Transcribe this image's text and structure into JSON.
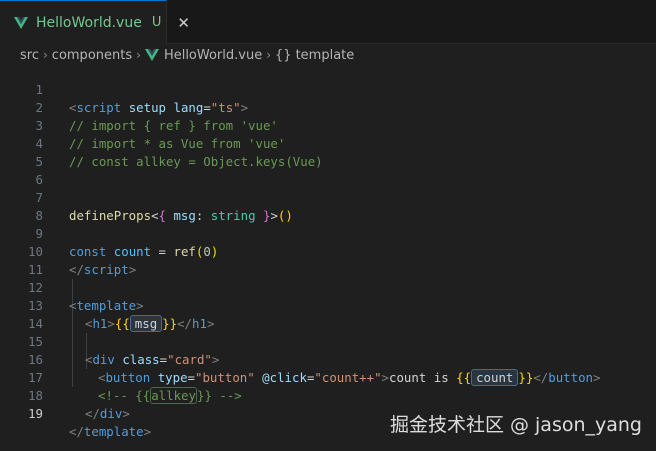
{
  "tab": {
    "title": "HelloWorld.vue",
    "status": "U",
    "close_glyph": "✕",
    "icon": "vue-icon"
  },
  "breadcrumb": {
    "items": [
      "src",
      "components",
      "HelloWorld.vue",
      "template"
    ],
    "braces": "{}",
    "separator": "›"
  },
  "editor": {
    "current_line": 19,
    "lines": [
      {
        "n": "1"
      },
      {
        "n": "2"
      },
      {
        "n": "3"
      },
      {
        "n": "4"
      },
      {
        "n": "5"
      },
      {
        "n": "6"
      },
      {
        "n": "7"
      },
      {
        "n": "8"
      },
      {
        "n": "9"
      },
      {
        "n": "10"
      },
      {
        "n": "11"
      },
      {
        "n": "12"
      },
      {
        "n": "13"
      },
      {
        "n": "14"
      },
      {
        "n": "15"
      },
      {
        "n": "16"
      },
      {
        "n": "17"
      },
      {
        "n": "18"
      },
      {
        "n": "19"
      }
    ],
    "tokens": {
      "l1": [
        "<",
        "script",
        " ",
        "setup",
        " ",
        "lang",
        "=",
        "\"ts\"",
        ">"
      ],
      "l2": "// import { ref } from 'vue'",
      "l3": "// import * as Vue from 'vue'",
      "l4": "// const allkey = Object.keys(Vue)",
      "l7": [
        "defineProps",
        "<",
        "{",
        " msg",
        ": ",
        "string",
        " }",
        ">",
        "(",
        ")"
      ],
      "l9": [
        "const",
        " ",
        "count",
        " = ",
        "ref",
        "(",
        "0",
        ")"
      ],
      "l10": [
        "</",
        "script",
        ">"
      ],
      "l12": [
        "<",
        "template",
        ">"
      ],
      "l13": [
        "<",
        "h1",
        ">",
        "{{",
        "msg",
        "}}",
        "</",
        "h1",
        ">"
      ],
      "l15": [
        "<",
        "div",
        " ",
        "class",
        "=",
        "\"card\"",
        ">"
      ],
      "l16": [
        "<",
        "button",
        " ",
        "type",
        "=",
        "\"button\"",
        " ",
        "@click",
        "=",
        "\"count++\"",
        ">",
        "count is ",
        "{{",
        "count",
        "}}",
        "</",
        "button",
        ">"
      ],
      "l17": [
        "<!-- {{",
        "allkey",
        "}} -->"
      ],
      "l18": [
        "</",
        "div",
        ">"
      ],
      "l19": [
        "</",
        "template",
        ">"
      ]
    }
  },
  "watermark": "掘金技术社区 @ jason_yang",
  "colors": {
    "background": "#1f1f1f",
    "tab_text": "#73c991",
    "vue_green": "#41b883",
    "tag": "#569cd6",
    "attr": "#9cdcfe",
    "string": "#ce9178",
    "comment": "#6a9955"
  }
}
